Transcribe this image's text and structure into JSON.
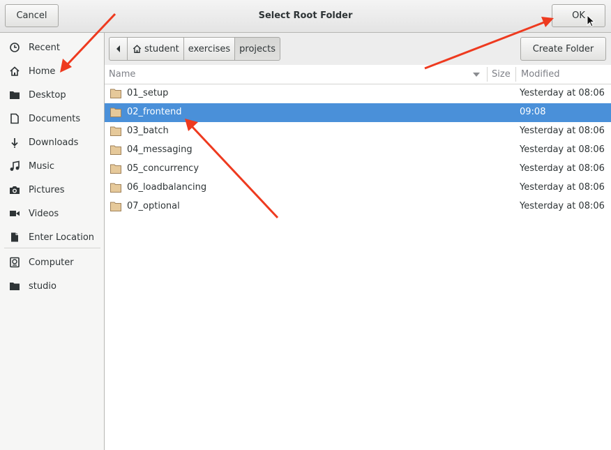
{
  "dialog": {
    "title": "Select Root Folder",
    "cancel_label": "Cancel",
    "ok_label": "OK"
  },
  "sidebar": {
    "items": [
      {
        "label": "Recent",
        "icon": "clock-icon"
      },
      {
        "label": "Home",
        "icon": "home-icon"
      },
      {
        "label": "Desktop",
        "icon": "desktop-folder-icon"
      },
      {
        "label": "Documents",
        "icon": "document-icon"
      },
      {
        "label": "Downloads",
        "icon": "download-icon"
      },
      {
        "label": "Music",
        "icon": "music-icon"
      },
      {
        "label": "Pictures",
        "icon": "camera-icon"
      },
      {
        "label": "Videos",
        "icon": "video-icon"
      },
      {
        "label": "Enter Location",
        "icon": "location-file-icon"
      },
      {
        "label": "Computer",
        "icon": "computer-icon"
      },
      {
        "label": "studio",
        "icon": "folder-icon"
      }
    ]
  },
  "pathbar": {
    "segments": [
      "student",
      "exercises",
      "projects"
    ],
    "active": "projects"
  },
  "toolbar": {
    "create_folder_label": "Create Folder"
  },
  "file_list": {
    "columns": [
      "Name",
      "Size",
      "Modified"
    ],
    "rows": [
      {
        "name": "01_setup",
        "modified": "Yesterday at 08:06",
        "selected": false
      },
      {
        "name": "02_frontend",
        "modified": "09:08",
        "selected": true
      },
      {
        "name": "03_batch",
        "modified": "Yesterday at 08:06",
        "selected": false
      },
      {
        "name": "04_messaging",
        "modified": "Yesterday at 08:06",
        "selected": false
      },
      {
        "name": "05_concurrency",
        "modified": "Yesterday at 08:06",
        "selected": false
      },
      {
        "name": "06_loadbalancing",
        "modified": "Yesterday at 08:06",
        "selected": false
      },
      {
        "name": "07_optional",
        "modified": "Yesterday at 08:06",
        "selected": false
      }
    ]
  },
  "colors": {
    "selection": "#4a90d9",
    "annotation_arrow": "#ee3a1f",
    "folder_fill": "#e6c99a"
  }
}
